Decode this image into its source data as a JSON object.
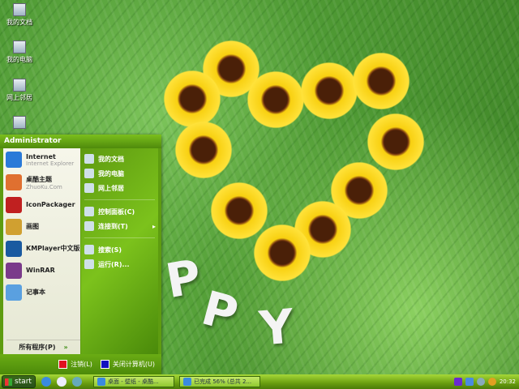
{
  "desktop": {
    "icons": [
      {
        "label": "我的文档"
      },
      {
        "label": "我的电脑"
      },
      {
        "label": "网上邻居"
      },
      {
        "label": ""
      }
    ],
    "letters": [
      "P",
      "P",
      "Y"
    ]
  },
  "start_menu": {
    "user": "Administrator",
    "left_items": [
      {
        "title": "Internet",
        "subtitle": "Internet Explorer",
        "icon": "internet-explorer-icon",
        "color": "#2a7ad8"
      },
      {
        "title": "桌酷主题",
        "subtitle": "ZhuoKu.Com",
        "icon": "zhuoku-icon",
        "color": "#e07030"
      },
      {
        "title": "IconPackager",
        "subtitle": "",
        "icon": "iconpackager-icon",
        "color": "#c02020"
      },
      {
        "title": "画图",
        "subtitle": "",
        "icon": "paint-icon",
        "color": "#d0a030"
      },
      {
        "title": "KMPlayer中文版",
        "subtitle": "",
        "icon": "kmplayer-icon",
        "color": "#1a5aa0"
      },
      {
        "title": "WinRAR",
        "subtitle": "",
        "icon": "winrar-icon",
        "color": "#7a3a8a"
      },
      {
        "title": "记事本",
        "subtitle": "",
        "icon": "notepad-icon",
        "color": "#5aa0e0"
      }
    ],
    "all_programs": "所有程序(P)",
    "right_items": [
      {
        "label": "我的文档",
        "icon": "my-documents-icon"
      },
      {
        "label": "我的电脑",
        "icon": "my-computer-icon"
      },
      {
        "label": "网上邻居",
        "icon": "network-icon"
      },
      {
        "label": "控制面板(C)",
        "icon": "control-panel-icon"
      },
      {
        "label": "连接到(T)",
        "icon": "connect-icon",
        "arrow": "▸"
      },
      {
        "label": "搜索(S)",
        "icon": "search-icon"
      },
      {
        "label": "运行(R)...",
        "icon": "run-icon"
      }
    ],
    "logoff": "注销(L)",
    "shutdown": "关闭计算机(U)"
  },
  "taskbar": {
    "start": "start",
    "tasks": [
      "桌面 - 壁纸 - 桌酷...",
      "已完成 56% (总共 2..."
    ],
    "clock": "20:32"
  },
  "colors": {
    "accent": "#6aac14",
    "logoff": "#e01020",
    "shutdown": "#1010c0"
  }
}
